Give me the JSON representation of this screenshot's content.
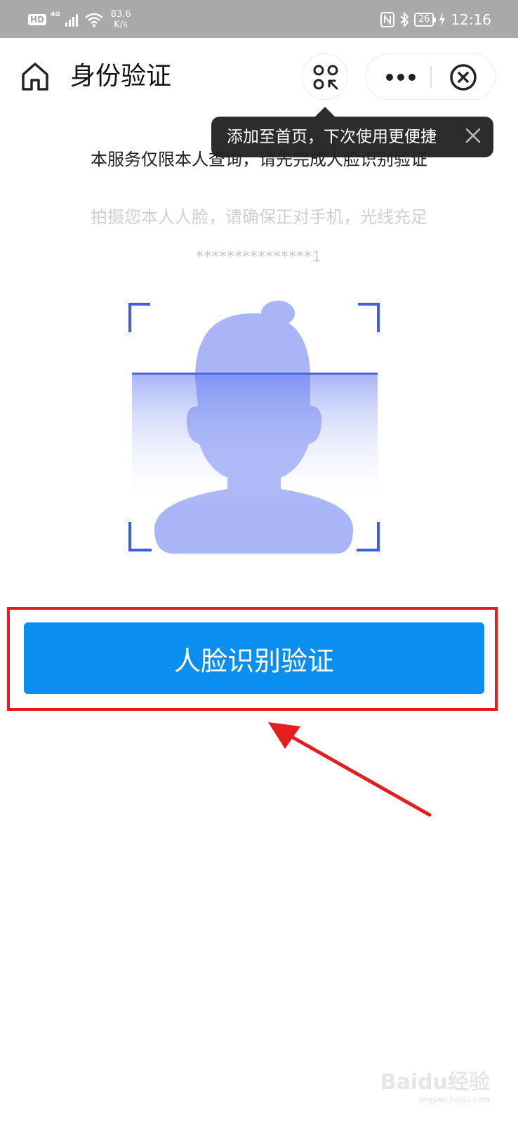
{
  "status_bar": {
    "hd": "HD",
    "network": "4G",
    "speed_value": "83.6",
    "speed_unit": "K/s",
    "battery": "26",
    "time": "12:16"
  },
  "header": {
    "title": "身份验证"
  },
  "tooltip": {
    "text": "添加至首页，下次使用更便捷"
  },
  "content": {
    "instruction": "本服务仅限本人查询，请先完成人脸识别验证",
    "hint": "拍摄您本人人脸，请确保正对手机，光线充足",
    "masked_id": "***************1"
  },
  "actions": {
    "face_verify_label": "人脸识别验证"
  },
  "colors": {
    "primary_button": "#0a8ef0",
    "face_fill": "#a9b5f7",
    "frame_corner": "#3d5fe6",
    "highlight": "#e41e1e"
  },
  "watermark": {
    "logo": "Baidu经验",
    "sub": "jingyan.baidu.com"
  }
}
